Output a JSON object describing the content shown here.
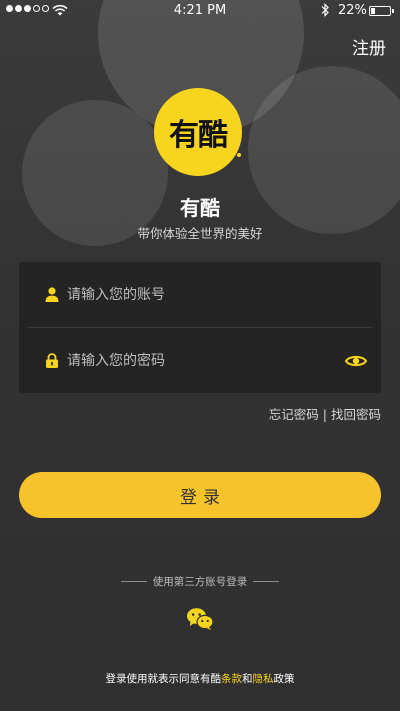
{
  "status_bar": {
    "time": "4:21 PM",
    "battery_percent": "22%",
    "battery_level": 0.22,
    "signal_bars_filled": 3,
    "signal_bars_total": 5
  },
  "header": {
    "register_label": "注册"
  },
  "brand": {
    "logo_text": "有酷",
    "app_name": "有酷",
    "slogan": "带你体验全世界的美好",
    "accent_color": "#f7d51f"
  },
  "form": {
    "account_placeholder": "请输入您的账号",
    "account_value": "",
    "password_placeholder": "请输入您的密码",
    "password_value": "",
    "account_icon": "user-icon",
    "password_icon": "lock-icon",
    "visibility_icon": "eye-icon"
  },
  "links": {
    "forgot_password": "忘记密码",
    "separator": " | ",
    "recover_password": "找回密码"
  },
  "actions": {
    "login_label": "登录",
    "login_color": "#f6c32a"
  },
  "third_party": {
    "label": "使用第三方账号登录",
    "wechat_icon": "wechat-icon"
  },
  "agreement": {
    "prefix": "登录使用就表示同意有酷",
    "terms": "条款",
    "conjunction": "和",
    "privacy": "隐私",
    "suffix": "政策"
  }
}
